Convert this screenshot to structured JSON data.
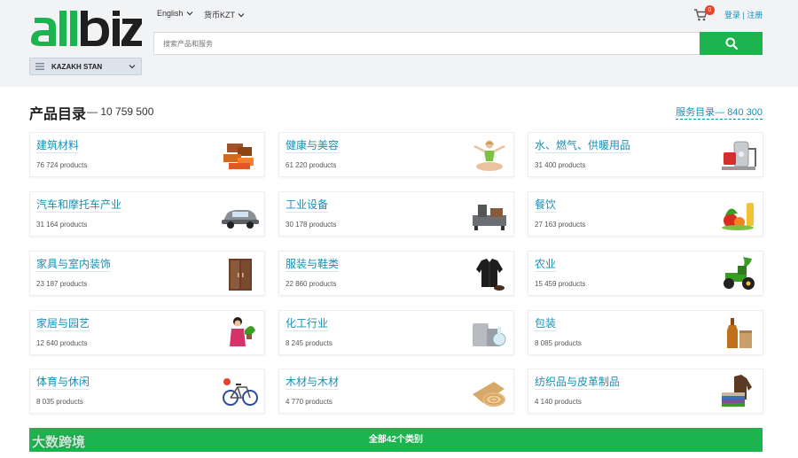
{
  "header": {
    "language": "English",
    "currency": "货币KZT",
    "cart_count": "0",
    "login": "登录",
    "separator": "|",
    "register": "注册",
    "search_placeholder": "搜索产品和服务",
    "country": "KAZAKH STAN",
    "colors": {
      "brand_green": "#1cb44e",
      "brand_dark": "#1f1f1f",
      "link": "#1a8fb5"
    }
  },
  "catalog": {
    "title": "产品目录",
    "count": "— 10 759 500",
    "services_link": "服务目录— 840 300",
    "categories": [
      {
        "name": "建筑材料",
        "count": "76 724 products",
        "icon": "bricks-icon"
      },
      {
        "name": "健康与美容",
        "count": "61 220 products",
        "icon": "yoga-woman-icon"
      },
      {
        "name": "水、燃气、供暖用品",
        "count": "31 400 products",
        "icon": "water-heater-icon"
      },
      {
        "name": "汽车和摩托车产业",
        "count": "31 164 products",
        "icon": "car-icon"
      },
      {
        "name": "工业设备",
        "count": "30 178 products",
        "icon": "machine-icon"
      },
      {
        "name": "餐饮",
        "count": "27 163 products",
        "icon": "food-icon"
      },
      {
        "name": "家具与室内装饰",
        "count": "23 187 products",
        "icon": "wardrobe-icon"
      },
      {
        "name": "服装与鞋类",
        "count": "22 860 products",
        "icon": "jacket-icon"
      },
      {
        "name": "农业",
        "count": "15 459 products",
        "icon": "tractor-icon"
      },
      {
        "name": "家居与园艺",
        "count": "12 640 products",
        "icon": "gardener-icon"
      },
      {
        "name": "化工行业",
        "count": "8 245 products",
        "icon": "chemical-tanks-icon"
      },
      {
        "name": "包装",
        "count": "8 085 products",
        "icon": "bottle-bag-icon"
      },
      {
        "name": "体育与休闲",
        "count": "8 035 products",
        "icon": "bicycle-icon"
      },
      {
        "name": "木材与木材",
        "count": "4 770 products",
        "icon": "wood-logs-icon"
      },
      {
        "name": "纺织品与皮革制品",
        "count": "4 140 products",
        "icon": "fabric-leather-icon"
      }
    ]
  },
  "all_categories": "全部42个类别",
  "watermark": "大数跨境"
}
